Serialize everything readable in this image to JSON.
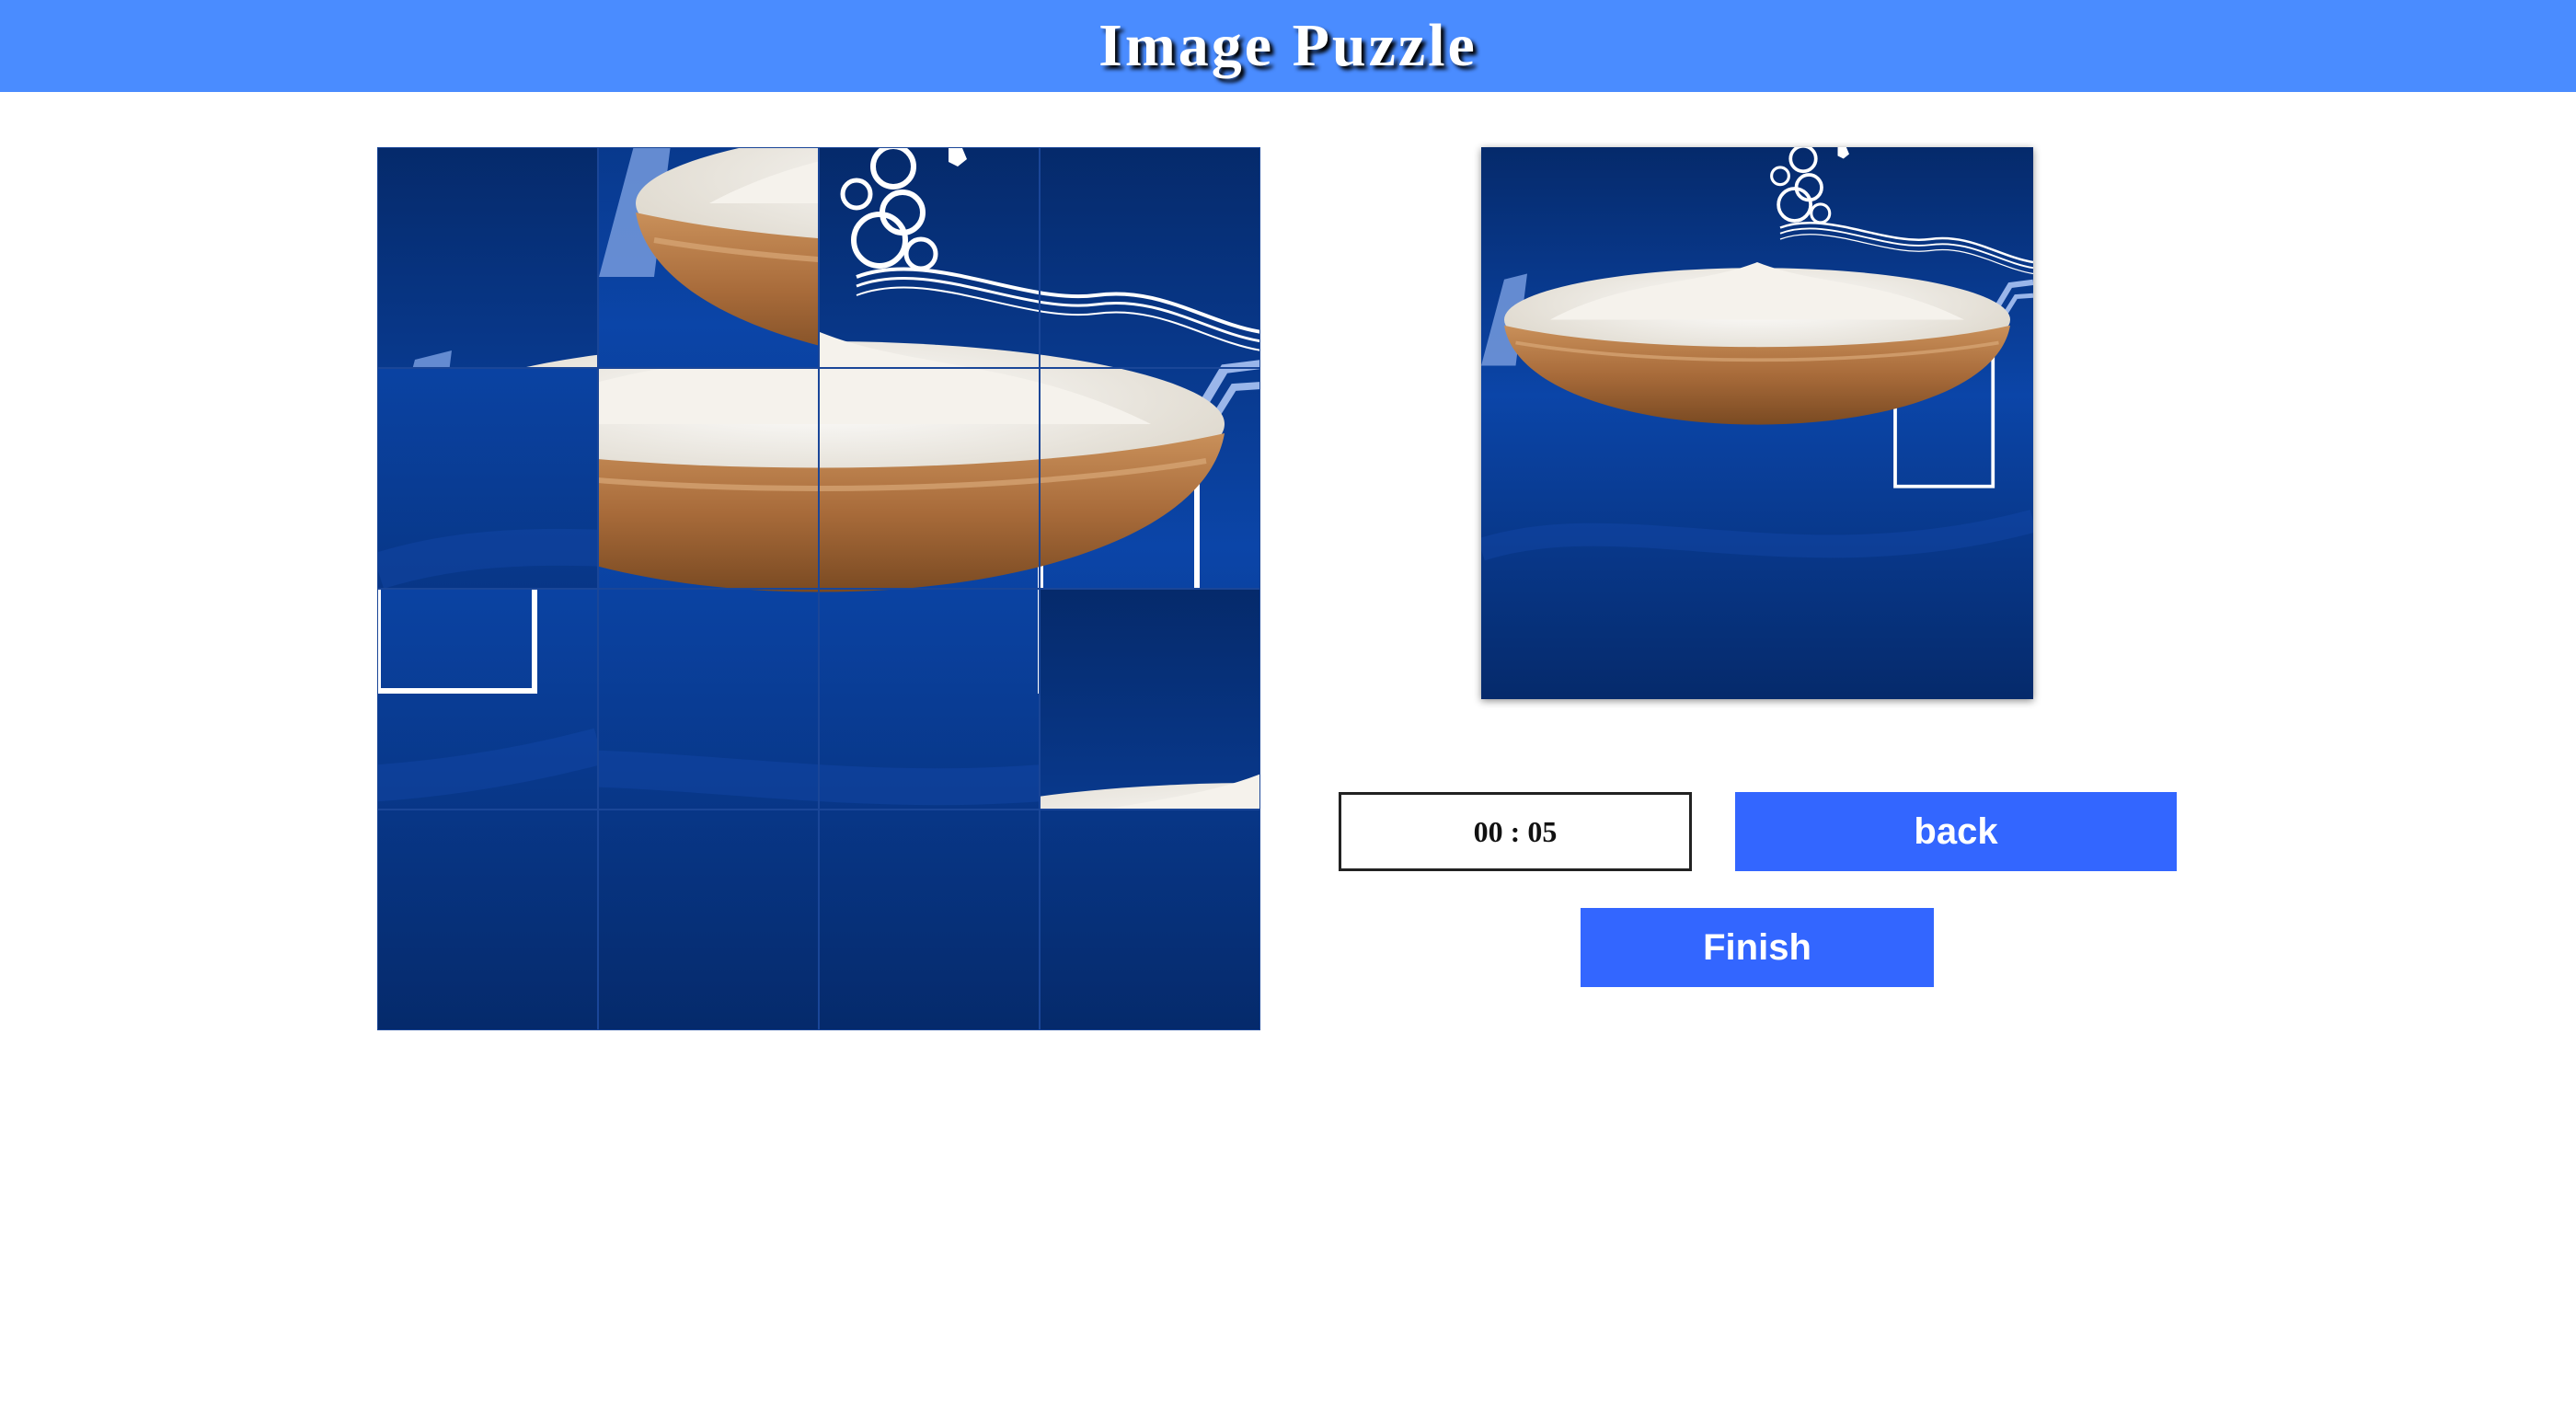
{
  "header": {
    "title": "Image Puzzle"
  },
  "timer": {
    "value": "00 : 05"
  },
  "buttons": {
    "back_label": "back",
    "finish_label": "Finish"
  },
  "colors": {
    "header_bg": "#4a8cff",
    "button_bg": "#3366ff",
    "image_bg": "#0b3a8f"
  },
  "puzzle": {
    "grid_size": 4,
    "tile_order": [
      1,
      5,
      3,
      4,
      9,
      6,
      7,
      8,
      12,
      10,
      11,
      2,
      13,
      14,
      15,
      16
    ]
  }
}
